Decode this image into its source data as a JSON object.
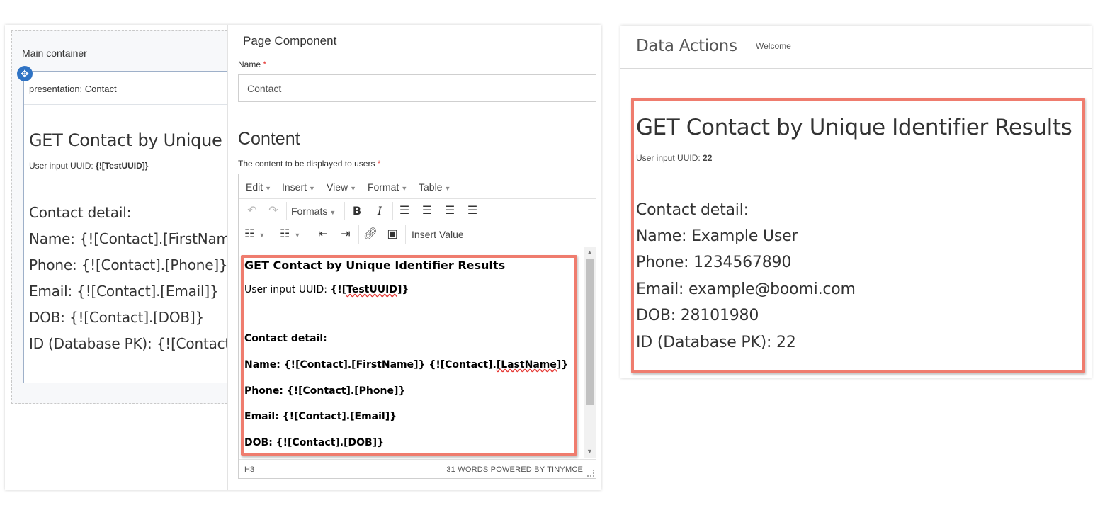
{
  "designer": {
    "main_container_title": "Main container",
    "presentation_label": "presentation: Contact",
    "preview": {
      "title": "GET Contact by Unique Ide",
      "uuid_label": "User input UUID: ",
      "uuid_value": "{![TestUUID]}",
      "contact_detail": "Contact detail:",
      "name": "Name: {![Contact].[FirstName]",
      "phone": "Phone: {![Contact].[Phone]}",
      "email": "Email: {![Contact].[Email]}",
      "dob": "DOB: {![Contact].[DOB]}",
      "id": "ID (Database PK): {![Contact].[I"
    }
  },
  "properties": {
    "title": "Page Component",
    "name_label": "Name",
    "required_mark": "*",
    "name_value": "Contact",
    "content_title": "Content",
    "content_label": "The content to be displayed to users"
  },
  "editor": {
    "menu": [
      "Edit",
      "Insert",
      "View",
      "Format",
      "Table"
    ],
    "formats_label": "Formats",
    "insert_value_label": "Insert Value",
    "lines": {
      "title": "GET Contact by Unique Identifier Results",
      "uuid_label": "User input UUID: ",
      "uuid_prefix": "{![",
      "uuid_word": "TestUUID",
      "uuid_suffix": "]}",
      "contact_detail": "Contact detail:",
      "name_prefix": "Name: {![Contact].[FirstName]} {![Contact].",
      "name_word": "[LastName",
      "name_suffix": "]}",
      "phone": "Phone: {![Contact].[Phone]}",
      "email": "Email: {![Contact].[Email]}",
      "dob": "DOB: {![Contact].[DOB]}"
    },
    "status_path": "H3",
    "status_words": "31 WORDS POWERED BY TINYMCE"
  },
  "runtime": {
    "app_title": "Data Actions",
    "welcome": "Welcome",
    "result": {
      "title": "GET Contact by Unique Identifier Results",
      "uuid_label": "User input UUID: ",
      "uuid_value": "22",
      "contact_detail": "Contact detail:",
      "name": "Name: Example User",
      "phone": "Phone: 1234567890",
      "email": "Email: example@boomi.com",
      "dob": "DOB: 28101980",
      "id": "ID (Database PK): 22"
    }
  },
  "colors": {
    "highlight": "#ef7c6e",
    "drag_handle": "#2f73c4",
    "required": "#e53935"
  }
}
